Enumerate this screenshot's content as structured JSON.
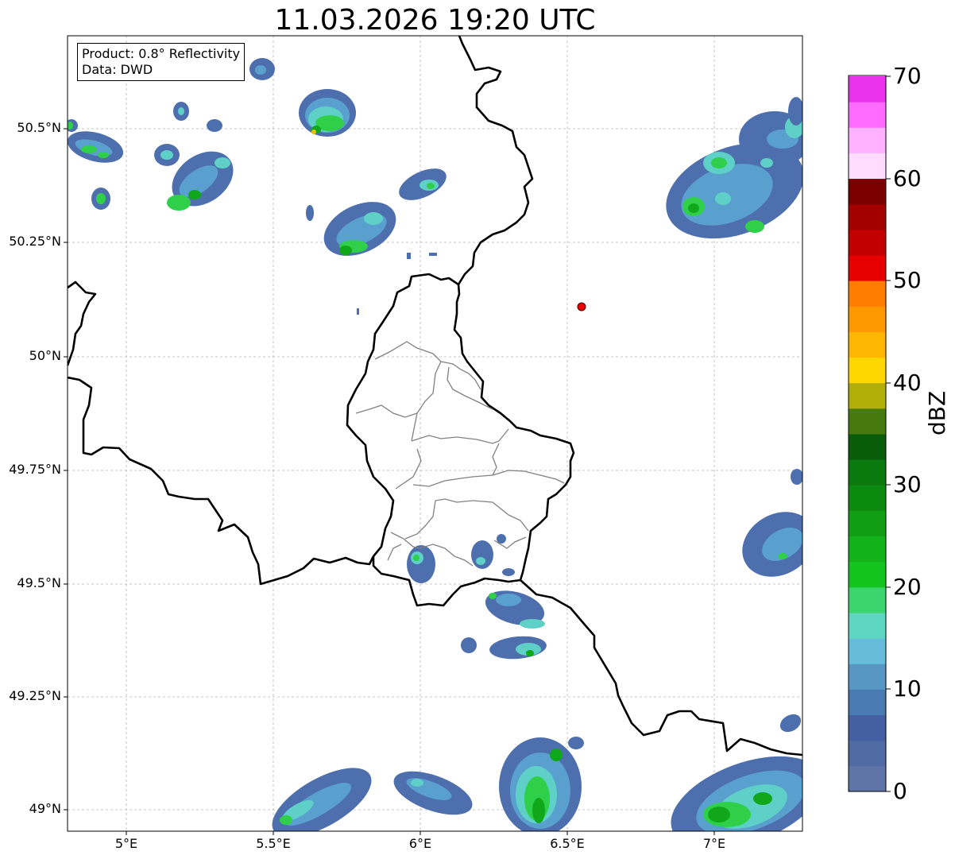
{
  "title": "11.03.2026 19:20 UTC",
  "info": {
    "product": "Product: 0.8° Reflectivity",
    "source": "Data: DWD"
  },
  "axes": {
    "lon_labels": [
      "5°E",
      "5.5°E",
      "6°E",
      "6.5°E",
      "7°E"
    ],
    "lat_labels": [
      "50.5°N",
      "50.25°N",
      "50°N",
      "49.75°N",
      "49.5°N",
      "49.25°N",
      "49°N"
    ],
    "lon_range": [
      4.8,
      7.3
    ],
    "lat_range": [
      48.95,
      50.7
    ],
    "grid": true
  },
  "colorbar": {
    "label": "dBZ",
    "ticks": [
      "70",
      "60",
      "50",
      "40",
      "30",
      "20",
      "10",
      "0"
    ],
    "range": [
      0,
      70
    ],
    "step": 2.5,
    "colors": [
      "#5f75a8",
      "#506aa3",
      "#445fa2",
      "#4a7ab2",
      "#5897c3",
      "#66bcdb",
      "#5fd6c0",
      "#3cd46c",
      "#14c41e",
      "#12b21a",
      "#0f9e14",
      "#0c8a10",
      "#0b7a0e",
      "#085c0a",
      "#477a0c",
      "#afaf08",
      "#ffd600",
      "#ffb600",
      "#ff9800",
      "#ff7e00",
      "#e60000",
      "#c20000",
      "#a40000",
      "#7a0000",
      "#ffdcff",
      "#ffb2ff",
      "#ff6bff",
      "#ea33ea"
    ]
  },
  "map_features": {
    "marker": {
      "lon": 6.55,
      "lat": 50.11,
      "color": "#ee0000"
    },
    "country_border_color": "#000000",
    "district_border_color": "#808080"
  },
  "echo_colors": {
    "low": "#4e6fad",
    "mid": "#5aa0cf",
    "cyan": "#5fd0c8",
    "green": "#2fcf4a",
    "dgreen": "#10a81a",
    "yellow": "#e8c000"
  }
}
